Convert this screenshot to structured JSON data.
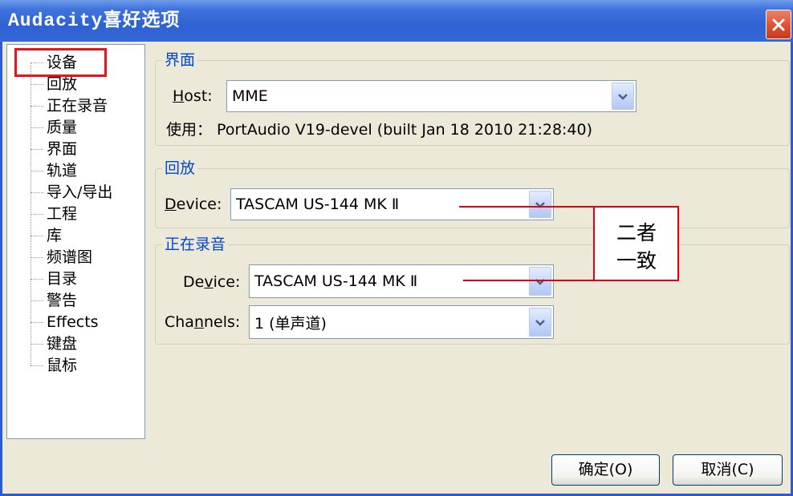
{
  "window": {
    "title": "Audacity喜好选项"
  },
  "icons": {
    "close": "close-icon",
    "dropdown": "chevron-down-icon"
  },
  "sidebar": {
    "items": [
      {
        "label": "设备",
        "selected": true
      },
      {
        "label": "回放"
      },
      {
        "label": "正在录音"
      },
      {
        "label": "质量"
      },
      {
        "label": "界面"
      },
      {
        "label": "轨道"
      },
      {
        "label": "导入/导出"
      },
      {
        "label": "工程"
      },
      {
        "label": "库"
      },
      {
        "label": "频谱图"
      },
      {
        "label": "目录"
      },
      {
        "label": "警告"
      },
      {
        "label": "Effects"
      },
      {
        "label": "键盘"
      },
      {
        "label": "鼠标"
      }
    ]
  },
  "interface_group": {
    "title": "界面",
    "host_label": "Host:",
    "host_mnemonic_index": 0,
    "host_value": "MME",
    "using_text": "使用： PortAudio V19-devel (built Jan 18 2010 21:28:40)"
  },
  "playback_group": {
    "title": "回放",
    "device_label": "Device:",
    "device_mnemonic_index": 0,
    "device_value": "TASCAM US-144 MK Ⅱ"
  },
  "recording_group": {
    "title": "正在录音",
    "device_label": "Device:",
    "device_mnemonic_index": 2,
    "device_value": "TASCAM US-144 MK Ⅱ",
    "channels_label": "Channels:",
    "channels_mnemonic_index": 3,
    "channels_value": "1 (单声道)"
  },
  "annotation": {
    "line1": "二者",
    "line2": "一致"
  },
  "buttons": {
    "ok_label": "确定(O)",
    "cancel_label": "取消(C)"
  },
  "colors": {
    "title_bar": "#2E62D3",
    "dialog_background": "#ECE9D8",
    "group_title": "#0046D5",
    "group_border": "#D0D0BF",
    "input_border": "#7F9DB9",
    "button_border": "#003C74",
    "close_button": "#DD5133",
    "annotation_red": "#E60012",
    "selection_box": "#E8141A"
  }
}
